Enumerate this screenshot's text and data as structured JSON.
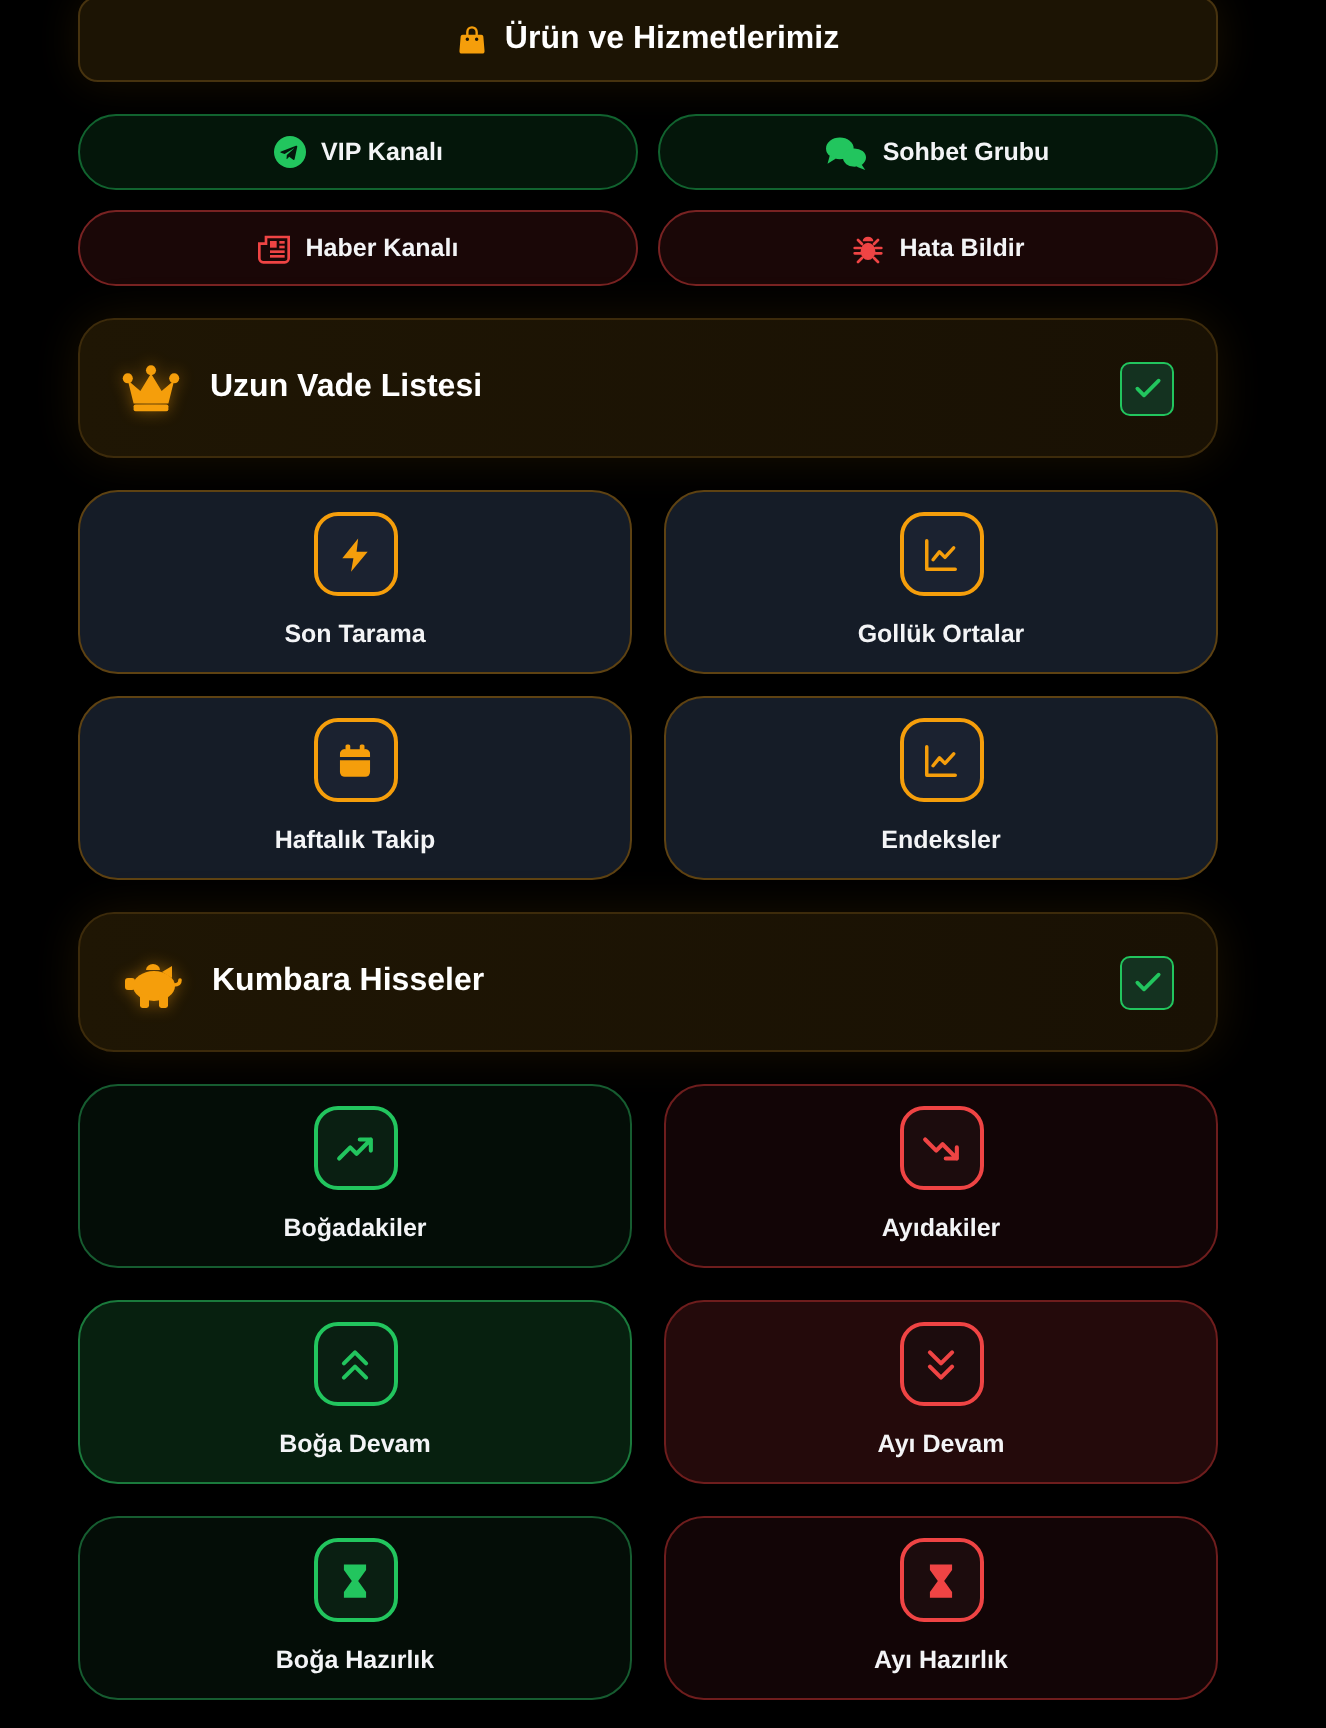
{
  "header": {
    "title": "Ürün ve Hizmetlerimiz"
  },
  "links": [
    {
      "label": "VIP Kanalı",
      "color": "#22c55e"
    },
    {
      "label": "Sohbet Grubu",
      "color": "#22c55e"
    },
    {
      "label": "Haber Kanalı",
      "color": "#ef4444"
    },
    {
      "label": "Hata Bildir",
      "color": "#ef4444"
    }
  ],
  "sections": [
    {
      "title": "Uzun Vade Listesi",
      "checked": true,
      "cards": [
        {
          "label": "Son Tarama",
          "kind": "neutral",
          "highlighted": false
        },
        {
          "label": "Gollük Ortalar",
          "kind": "neutral",
          "highlighted": false
        },
        {
          "label": "Haftalık Takip",
          "kind": "neutral",
          "highlighted": false
        },
        {
          "label": "Endeksler",
          "kind": "neutral",
          "highlighted": false
        }
      ]
    },
    {
      "title": "Kumbara Hisseler",
      "checked": true,
      "cards": [
        {
          "label": "Boğadakiler",
          "kind": "bull",
          "highlighted": false
        },
        {
          "label": "Ayıdakiler",
          "kind": "bear",
          "highlighted": false
        },
        {
          "label": "Boğa Devam",
          "kind": "bull",
          "highlighted": true
        },
        {
          "label": "Ayı Devam",
          "kind": "bear",
          "highlighted": true
        },
        {
          "label": "Boğa Hazırlık",
          "kind": "bull",
          "highlighted": false
        },
        {
          "label": "Ayı Hazırlık",
          "kind": "bear",
          "highlighted": false
        }
      ]
    }
  ]
}
